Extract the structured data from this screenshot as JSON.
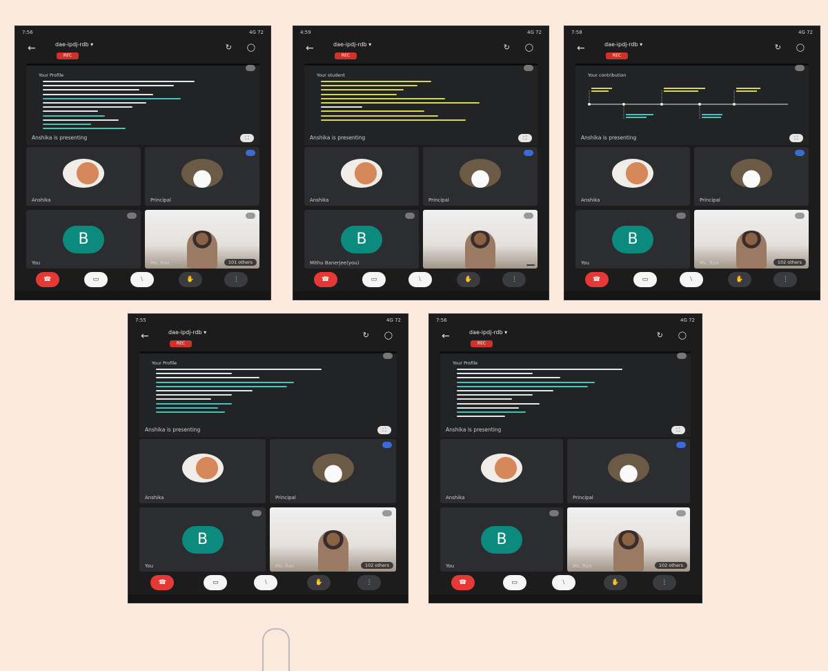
{
  "phones": [
    {
      "status_left": "7:56",
      "status_right": "4G 72",
      "meeting_code": "dae-ipdj-rdb",
      "rec_label": "REC",
      "slide_title": "Your Profile",
      "presenting_text": "Anshika is presenting",
      "tile1_name": "Anshika",
      "tile2_name": "Principal",
      "tile3_name": "You",
      "tile3_initial": "B",
      "tile4_name": "Ms. Rao",
      "tile4_others": "101 others"
    },
    {
      "status_left": "4:59",
      "status_right": "4G 72",
      "meeting_code": "dae-ipdj-rdb",
      "rec_label": "REC",
      "slide_title": "Your student",
      "presenting_text": "Anshika is presenting",
      "tile1_name": "Anshika",
      "tile2_name": "Principal",
      "tile3_name": "Mithu Banerjee(you)",
      "tile3_initial": "B",
      "tile4_name": "",
      "tile4_others": ""
    },
    {
      "status_left": "7:58",
      "status_right": "4G 72",
      "meeting_code": "dae-ipdj-rdb",
      "rec_label": "REC",
      "slide_title": "Your contribution",
      "presenting_text": "Anshika is presenting",
      "tile1_name": "Anshika",
      "tile2_name": "Principal",
      "tile3_name": "You",
      "tile3_initial": "B",
      "tile4_name": "Ms. Rao",
      "tile4_others": "102 others"
    },
    {
      "status_left": "7:55",
      "status_right": "4G 72",
      "meeting_code": "dae-ipdj-rdb",
      "rec_label": "REC",
      "slide_title": "Your Profile",
      "presenting_text": "Anshika is presenting",
      "tile1_name": "Anshika",
      "tile2_name": "Principal",
      "tile3_name": "You",
      "tile3_initial": "B",
      "tile4_name": "Ms. Rao",
      "tile4_others": "102 others"
    },
    {
      "status_left": "7:56",
      "status_right": "4G 72",
      "meeting_code": "dae-ipdj-rdb",
      "rec_label": "REC",
      "slide_title": "Your Profile",
      "presenting_text": "Anshika is presenting",
      "tile1_name": "Anshika",
      "tile2_name": "Principal",
      "tile3_name": "You",
      "tile3_initial": "B",
      "tile4_name": "Ms. Rao",
      "tile4_others": "102 others"
    }
  ],
  "colors": {
    "background": "#fbe9dd",
    "app_bg": "#1c1c1d",
    "rec": "#d0322a",
    "end_call": "#e53935",
    "avatar_teal": "#0c8a7e",
    "slide_text_white": "#e8e8e8",
    "slide_text_cyan": "#3fc7c0",
    "slide_text_yellow": "#d8d852"
  },
  "icons": [
    "back-arrow-icon",
    "switch-camera-icon",
    "headphones-icon",
    "end-call-icon",
    "camera-off-icon",
    "mic-off-icon",
    "hand-raise-icon",
    "more-options-icon",
    "expand-icon",
    "mic-muted-icon"
  ]
}
